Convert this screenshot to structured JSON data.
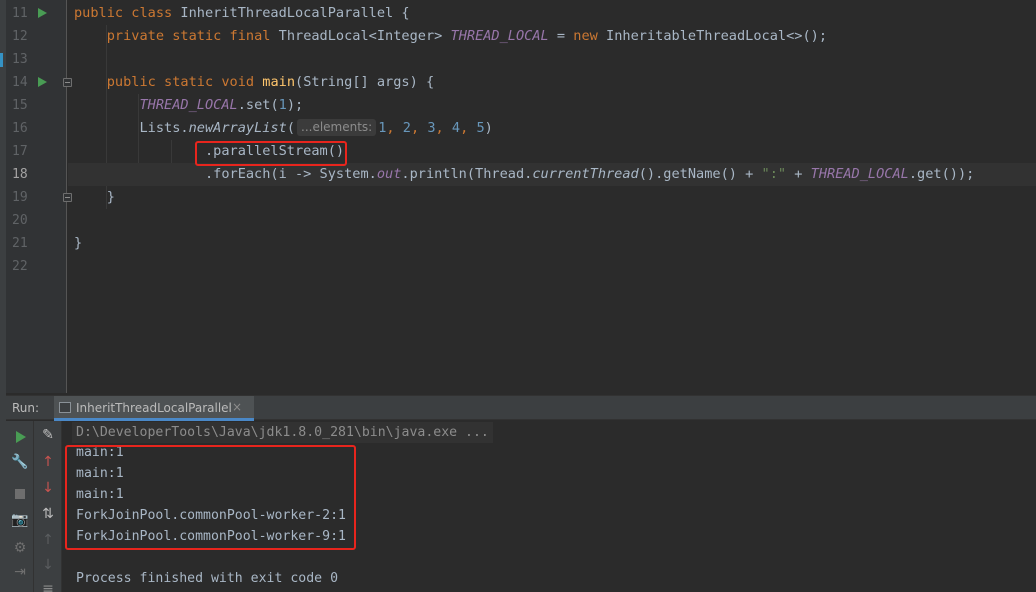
{
  "editor": {
    "line_numbers": [
      "11",
      "12",
      "13",
      "14",
      "15",
      "16",
      "17",
      "18",
      "19",
      "20",
      "21",
      "22"
    ],
    "tokens": {
      "public": "public",
      "class": "class",
      "private": "private",
      "static": "static",
      "final": "final",
      "void": "void",
      "new": "new",
      "class_name": "InheritThreadLocalParallel",
      "open_brace": " {",
      "close_brace": "}",
      "threadlocal_type": "ThreadLocal<Integer>",
      "thread_local_const": "THREAD_LOCAL",
      "assign": " = ",
      "inheritable": "InheritableThreadLocal<>();",
      "main": "main",
      "main_params": "(String[] args) {",
      "set_call": ".set(",
      "one": "1",
      "close_call": ");",
      "lists": "Lists.",
      "new_array_list": "newArrayList",
      "paren_open": "(",
      "hint_elements": "...elements:",
      "args_list_1": "1",
      "args_list_2": "2",
      "args_list_3": "3",
      "args_list_4": "4",
      "args_list_5": "5",
      "comma": ", ",
      "paren_close": ")",
      "parallel_stream": ".parallelStream()",
      "for_each_start": ".forEach(i -> System.",
      "out": "out",
      "println": ".println(Thread.",
      "current_thread": "currentThread",
      "get_name": "().getName() + ",
      "colon_str": "\":\"",
      "plus": " + ",
      "get_end": ".get());"
    }
  },
  "run_panel": {
    "label": "Run:",
    "tab_label": "InheritThreadLocalParallel",
    "tab_close": "×",
    "console": {
      "command": "D:\\DeveloperTools\\Java\\jdk1.8.0_281\\bin\\java.exe ...",
      "output": [
        "main:1",
        "main:1",
        "main:1",
        "ForkJoinPool.commonPool-worker-2:1",
        "ForkJoinPool.commonPool-worker-9:1"
      ],
      "exit_message": "Process finished with exit code 0"
    }
  },
  "colors": {
    "keyword": "#cc7832",
    "constant": "#9876aa",
    "function": "#ffc66d",
    "number": "#6897bb",
    "string": "#6a8759",
    "default_text": "#a9b7c6",
    "highlight_box": "#e8251d",
    "run_green": "#499c54"
  }
}
